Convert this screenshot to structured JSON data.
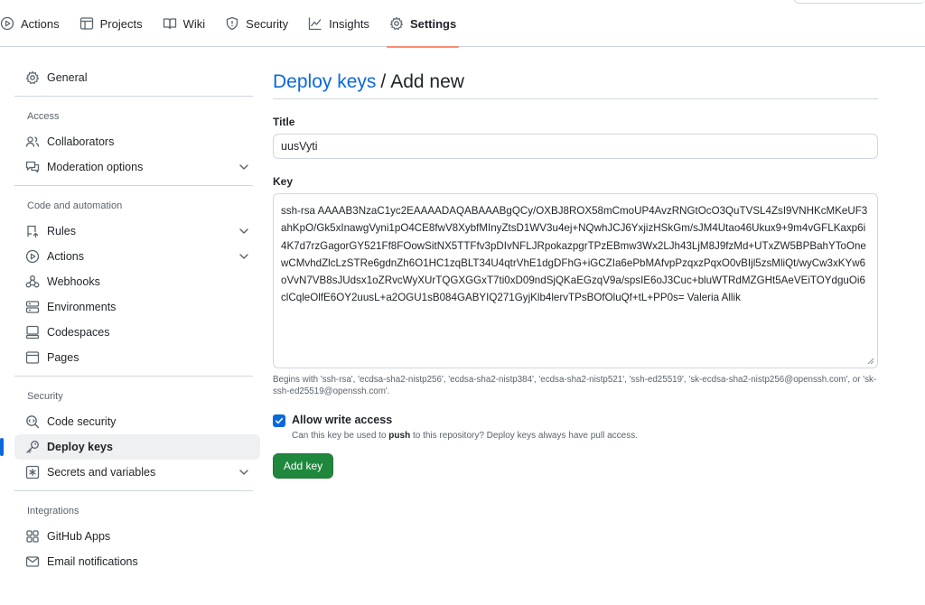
{
  "colors": {
    "accent": "#0969da",
    "active_tab_underline": "#fd8c73",
    "primary_button": "#1f883d",
    "border": "#d0d7de",
    "muted_text": "#59636e"
  },
  "repo_tabs": [
    {
      "label": "Actions",
      "icon": "play-icon"
    },
    {
      "label": "Projects",
      "icon": "table-icon"
    },
    {
      "label": "Wiki",
      "icon": "book-icon"
    },
    {
      "label": "Security",
      "icon": "shield-icon"
    },
    {
      "label": "Insights",
      "icon": "graph-icon"
    },
    {
      "label": "Settings",
      "icon": "gear-icon",
      "active": true
    }
  ],
  "sidebar": {
    "general": "General",
    "access_heading": "Access",
    "collaborators": "Collaborators",
    "moderation": "Moderation options",
    "code_heading": "Code and automation",
    "rules": "Rules",
    "actions": "Actions",
    "webhooks": "Webhooks",
    "environments": "Environments",
    "codespaces": "Codespaces",
    "pages": "Pages",
    "security_heading": "Security",
    "code_security": "Code security",
    "deploy_keys": "Deploy keys",
    "secrets": "Secrets and variables",
    "integrations_heading": "Integrations",
    "github_apps": "GitHub Apps",
    "email_notifications": "Email notifications"
  },
  "main": {
    "breadcrumb_link": "Deploy keys",
    "breadcrumb_sep": "/",
    "breadcrumb_current": "Add new",
    "title_label": "Title",
    "title_value": "uusVyti",
    "key_label": "Key",
    "key_value": "ssh-rsa AAAAB3NzaC1yc2EAAAADAQABAAABgQCy/OXBJ8ROX58mCmoUP4AvzRNGtOcO3QuTVSL4ZsI9VNHKcMKeUF3ahKpO/Gk5xInawgVyni1pO4CE8fwV8XybfMInyZtsD1WV3u4ej+NQwhJCJ6YxjizHSkGm/sJM4Utao46Ukux9+9m4vGFLKaxp6i4K7d7rzGagorGY521Ff8FOowSitNX5TTFfv3pDIvNFLJRpokazpgrTPzEBmw3Wx2LJh43LjM8J9fzMd+UTxZW5BPBahYToOnewCMvhdZlcLzSTRe6gdnZh6O1HC1zqBLT34U4qtrVhE1dgDFhG+iGCZIa6ePbMAfvpPzqxzPqxO0vBIjl5zsMliQt/wyCw3xKYw6oVvN7VB8sJUdsx1oZRvcWyXUrTQGXGGxT7ti0xD09ndSjQKaEGzqV9a/spsIE6oJ3Cuc+bluWTRdMZGHt5AeVEiTOYdguOi6clCqleOlfE6OY2uusL+a2OGU1sB084GABYIQ271GyjKlb4lervTPsBOfOluQf+tL+PP0s= Valeria Allik",
    "key_hint": "Begins with 'ssh-rsa', 'ecdsa-sha2-nistp256', 'ecdsa-sha2-nistp384', 'ecdsa-sha2-nistp521', 'ssh-ed25519', 'sk-ecdsa-sha2-nistp256@openssh.com', or 'sk-ssh-ed25519@openssh.com'.",
    "write_access_label": "Allow write access",
    "write_access_checked": true,
    "write_access_desc_pre": "Can this key be used to",
    "write_access_desc_bold": "push",
    "write_access_desc_post": "to this repository? Deploy keys always have pull access.",
    "add_button": "Add key"
  }
}
